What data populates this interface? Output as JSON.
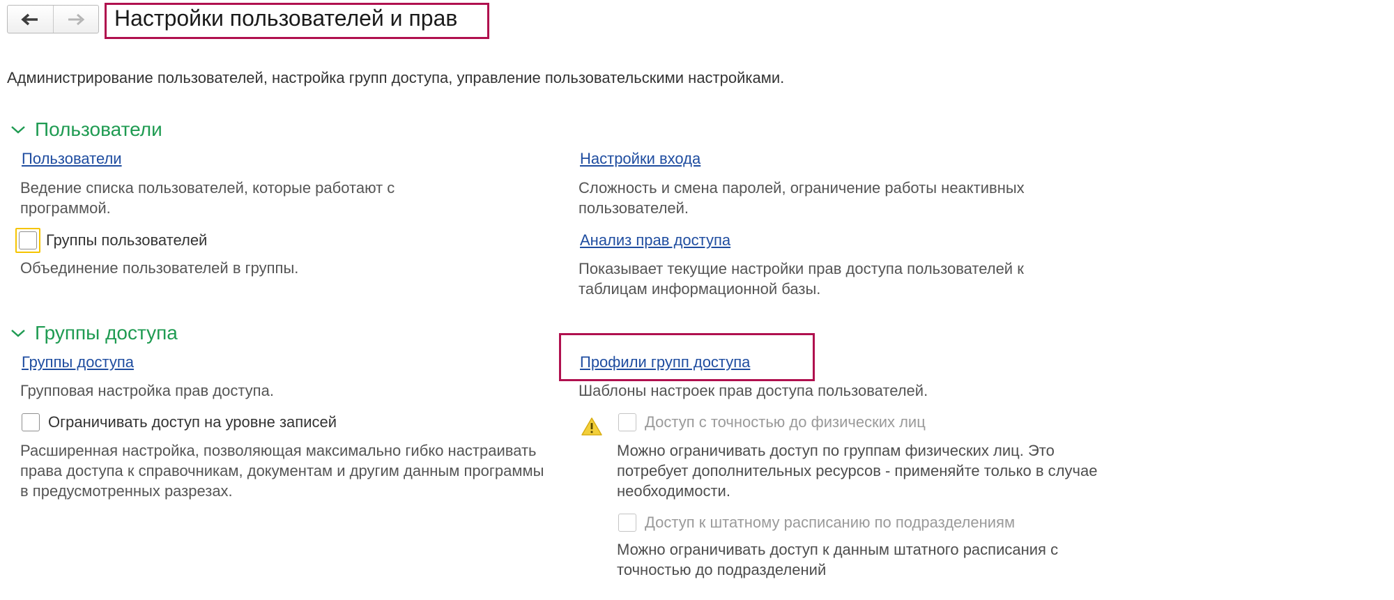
{
  "header": {
    "back_icon": "arrow-left-icon",
    "forward_icon": "arrow-right-icon",
    "title": "Настройки пользователей и прав",
    "subtitle": "Администрирование пользователей, настройка групп доступа, управление пользовательскими настройками."
  },
  "colors": {
    "accent_green": "#1f9b52",
    "link_blue": "#1f4da0",
    "highlight_magenta": "#b0104e",
    "focus_yellow": "#f5c400"
  },
  "users_section": {
    "title": "Пользователи",
    "users_link": "Пользователи",
    "users_desc": "Ведение списка пользователей, которые работают с программой.",
    "groups_checkbox_label": "Группы пользователей",
    "groups_checked": false,
    "groups_desc": "Объединение пользователей в группы.",
    "login_settings_link": "Настройки входа",
    "login_settings_desc": "Сложность и смена паролей, ограничение работы неактивных пользователей.",
    "rights_analysis_link": "Анализ прав доступа",
    "rights_analysis_desc": "Показывает текущие настройки прав доступа пользователей к таблицам информационной базы."
  },
  "access_section": {
    "title": "Группы доступа",
    "access_groups_link": "Группы доступа",
    "access_groups_desc": "Групповая настройка прав доступа.",
    "record_level_label": "Ограничивать доступ на уровне записей",
    "record_level_checked": false,
    "record_level_desc": "Расширенная настройка, позволяющая максимально гибко настраивать права доступа к справочникам, документам и другим данным программы в предусмотренных разрезах.",
    "profiles_link": "Профили групп доступа",
    "profiles_desc": "Шаблоны настроек прав доступа пользователей.",
    "warning_icon": "warning-triangle-icon",
    "individuals_label": "Доступ с точностью до физических лиц",
    "individuals_checked": false,
    "individuals_desc": "Можно ограничивать доступ по группам физических лиц. Это потребует дополнительных ресурсов - применяйте только в случае необходимости.",
    "staffing_label": "Доступ к штатному расписанию по подразделениям",
    "staffing_checked": false,
    "staffing_desc": "Можно ограничивать доступ к данным штатного расписания с точностью до подразделений"
  }
}
